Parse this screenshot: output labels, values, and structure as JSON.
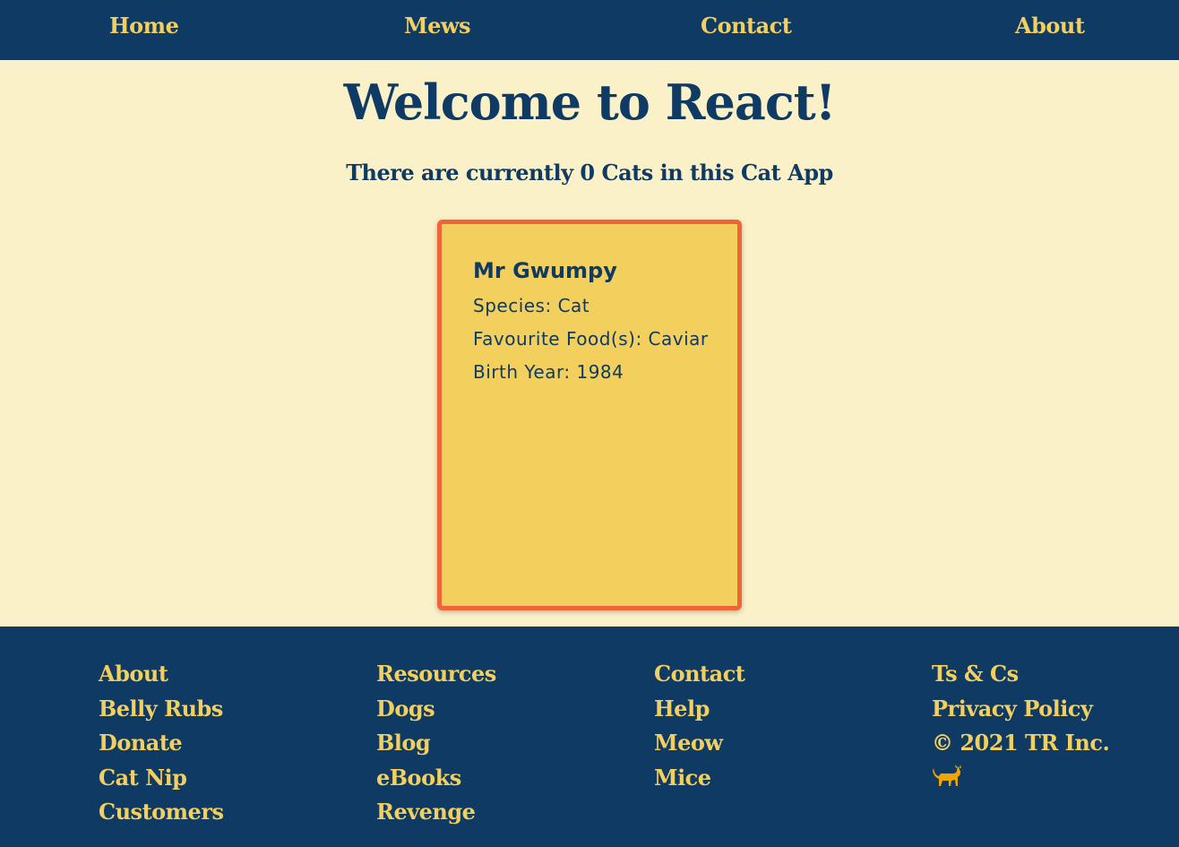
{
  "nav": {
    "items": [
      {
        "label": "Home"
      },
      {
        "label": "Mews"
      },
      {
        "label": "Contact"
      },
      {
        "label": "About"
      }
    ]
  },
  "main": {
    "title": "Welcome to React!",
    "subtitle": "There are currently 0 Cats in this Cat App"
  },
  "cat_card": {
    "name": "Mr Gwumpy",
    "species": "Species: Cat",
    "food": "Favourite Food(s): Caviar",
    "birth_year": "Birth Year: 1984"
  },
  "footer": {
    "columns": [
      [
        "About",
        "Belly Rubs",
        "Donate",
        "Cat Nip",
        "Customers"
      ],
      [
        "Resources",
        "Dogs",
        "Blog",
        "eBooks",
        "Revenge"
      ],
      [
        "Contact",
        "Help",
        "Meow",
        "Mice"
      ],
      [
        "Ts & Cs",
        "Privacy Policy",
        "© 2021 TR Inc."
      ]
    ],
    "icon": "cat-icon"
  },
  "colors": {
    "nav_bg": "#0e3a63",
    "nav_text": "#f2cf5f",
    "page_bg": "#fbf1c9",
    "card_bg": "#f3d05d",
    "card_border": "#f06438",
    "cat_icon": "#f0a500"
  }
}
